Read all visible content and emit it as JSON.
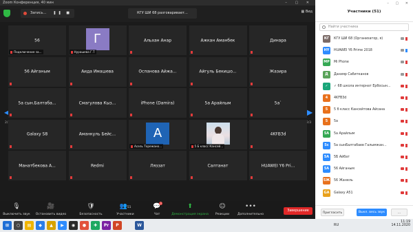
{
  "window": {
    "title": "Zoom Конференция, 40 мин"
  },
  "topbar": {
    "record_label": "Запись...",
    "meeting_title": "КГУ ШИ 68 разговаривает...",
    "view_label": "Вид"
  },
  "grid": {
    "page_left": "2/3",
    "page_right": "2/3",
    "tiles": [
      {
        "name": "56",
        "caption": "Подключение за..."
      },
      {
        "name": "",
        "caption": "Нурашева Г.Т",
        "avatar_letter": "Г",
        "avatar_color": "#8a7bc4"
      },
      {
        "name": "Альхан Анар",
        "caption": ""
      },
      {
        "name": "Ажкан Аманбек",
        "caption": ""
      },
      {
        "name": "Динара",
        "caption": ""
      },
      {
        "name": "56 Айганым",
        "caption": ""
      },
      {
        "name": "Аида Имашева",
        "caption": ""
      },
      {
        "name": "Оспанова  Айжа...",
        "caption": ""
      },
      {
        "name": "Айгуль  Бекишо...",
        "caption": ""
      },
      {
        "name": "Жазира",
        "caption": ""
      },
      {
        "name": "5а  сын.Балтаба...",
        "caption": ""
      },
      {
        "name": "Смагулова  Кыз...",
        "caption": ""
      },
      {
        "name": "iPhone (Damira)",
        "caption": ""
      },
      {
        "name": "5а Арайлым",
        "caption": ""
      },
      {
        "name": "5а`",
        "caption": ""
      },
      {
        "name": "Galaxy S8",
        "caption": ""
      },
      {
        "name": "Аманкуль  Бейс...",
        "caption": ""
      },
      {
        "name": "",
        "caption": "Асель Торежано...",
        "avatar_letter": "А",
        "avatar_color": "#1f64b5"
      },
      {
        "name": "",
        "caption": "5 Б класс Кансей...",
        "photo": true
      },
      {
        "name": "4KFB3d",
        "caption": ""
      },
      {
        "name": "Манатбекова  А...",
        "caption": ""
      },
      {
        "name": "Redmi",
        "caption": ""
      },
      {
        "name": "Ляззат",
        "caption": ""
      },
      {
        "name": "Салтанат",
        "caption": ""
      },
      {
        "name": "HUAWEI  Y6  Pri...",
        "caption": ""
      }
    ]
  },
  "toolbar": {
    "mute": "Выключить звук",
    "video": "Остановить видео",
    "security": "Безопасность",
    "participants": "Участники",
    "participants_count": "51",
    "chat": "Чат",
    "chat_badge": "3",
    "share": "Демонстрация экрана",
    "reactions": "Реакции",
    "more": "Дополнительно",
    "end": "Завершение"
  },
  "panel": {
    "title": "Участники (51)",
    "search_placeholder": "Найти участника",
    "participants": [
      {
        "initials": "КГ",
        "color": "#7a6a66",
        "name": "КГУ ШИ 68 (Организатор, я)",
        "mic_on": false,
        "video_off": false
      },
      {
        "initials": "HY",
        "color": "#2d8cff",
        "name": "HUAWEI Y6 Prime 2018",
        "mic_on": true,
        "video_off": false
      },
      {
        "initials": "MP",
        "color": "#34a853",
        "name": "Mi Phone",
        "mic_on": false,
        "video_off": false
      },
      {
        "initials": "Д",
        "color": "#5aa35a",
        "name": "Данияр Сабитканов",
        "mic_on": false,
        "video_off": false
      },
      {
        "initials": "✓",
        "color": "#1aa67a",
        "name": "✓ 68 школа интернат Ербосын...",
        "mic_on": false,
        "video_off": true
      },
      {
        "initials": "4",
        "color": "#e8711c",
        "name": "4KFB3d",
        "mic_on": false,
        "video_off": true
      },
      {
        "initials": "5",
        "color": "#e8711c",
        "name": "5 б класс Кансейтова Айсана",
        "mic_on": false,
        "video_off": true
      },
      {
        "initials": "5",
        "color": "#e8711c",
        "name": "5а",
        "mic_on": false,
        "video_off": true
      },
      {
        "initials": "5A",
        "color": "#34a853",
        "name": "5а Арайлым",
        "mic_on": false,
        "video_off": true
      },
      {
        "initials": "5с",
        "color": "#2d8cff",
        "name": "5а сынБалтабаев Галымжан...",
        "mic_on": false,
        "video_off": true
      },
      {
        "initials": "5A",
        "color": "#2d8cff",
        "name": "5Б Айбат",
        "mic_on": false,
        "video_off": true
      },
      {
        "initials": "5A",
        "color": "#2d8cff",
        "name": "56 Айганым",
        "mic_on": false,
        "video_off": true
      },
      {
        "initials": "5Ж",
        "color": "#e8711c",
        "name": "56 Жанель",
        "mic_on": false,
        "video_off": true
      },
      {
        "initials": "GA",
        "color": "#e8a11c",
        "name": "Galaxy A51",
        "mic_on": false,
        "video_off": true
      }
    ],
    "invite_label": "Пригласить",
    "muteall_label": "Выкл. весь звук",
    "more_label": "..."
  },
  "taskbar": {
    "lang": "RU",
    "time": "11:19",
    "date": "14.11.2020"
  }
}
